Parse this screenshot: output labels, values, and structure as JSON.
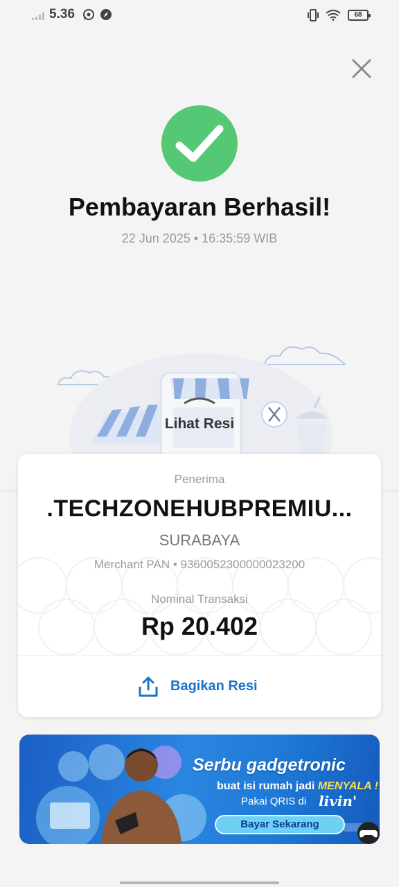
{
  "status_bar": {
    "time": "5.36",
    "battery": "68",
    "icons": [
      "signal-icon",
      "whatsapp-icon",
      "compass-icon",
      "vibrate-icon",
      "wifi-icon",
      "battery-icon"
    ]
  },
  "header": {
    "close_icon": "close-icon",
    "title": "Pembayaran Berhasil!",
    "datetime": "22 Jun 2025 • 16:35:59 WIB"
  },
  "illustration": {
    "link_label": "Lihat Resi"
  },
  "receipt": {
    "recipient_label": "Penerima",
    "merchant_name": ".TECHZONEHUBPREMIU...",
    "merchant_city": "SURABAYA",
    "merchant_pan": "Merchant PAN • 9360052300000023200",
    "amount_label": "Nominal Transaksi",
    "amount": "Rp 20.402",
    "share_label": "Bagikan Resi"
  },
  "promo_banner": {
    "headline": "Serbu gadgetronic",
    "sub_line_1": "buat isi rumah jadi",
    "sub_line_1_emphasis": "MENYALA !",
    "sub_line_2": "Pakai QRIS di",
    "brand": "livin'",
    "cta_label": "Bayar Sekarang"
  },
  "colors": {
    "success": "#54c875",
    "accent_blue": "#1a73c9",
    "banner_blue": "#2a86e0"
  }
}
